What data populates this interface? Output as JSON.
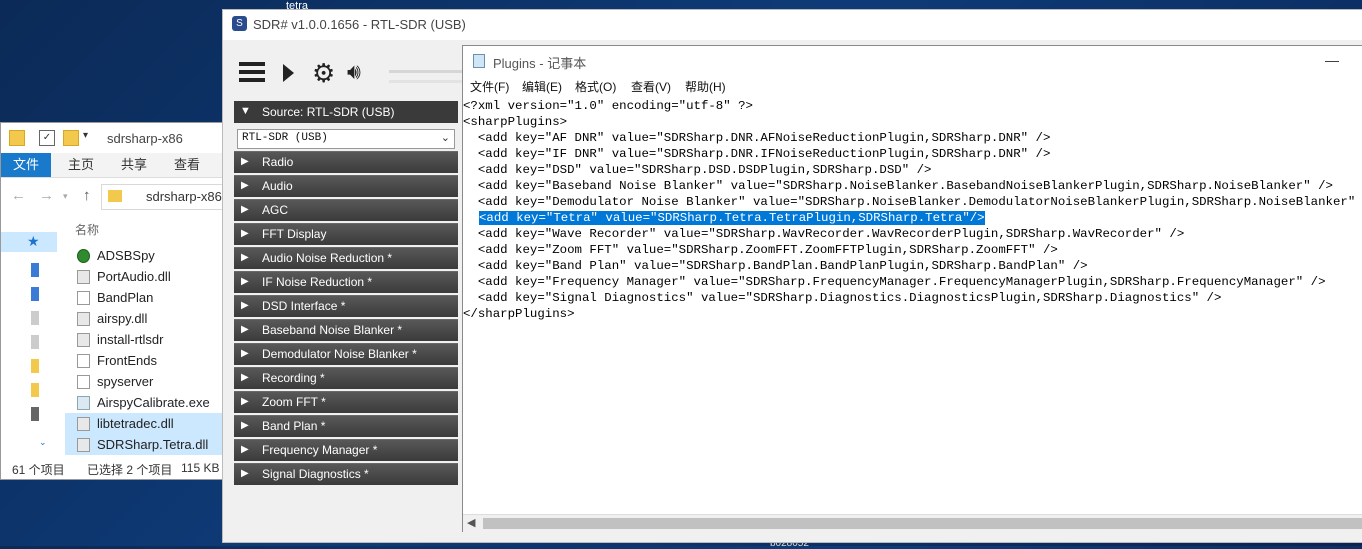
{
  "desktop": {
    "top_label": "tetra",
    "bottom_label": "b028052"
  },
  "explorer": {
    "title": "sdrsharp-x86",
    "ribbon_tabs": [
      "文件",
      "主页",
      "共享",
      "查看"
    ],
    "address": "sdrsharp-x86",
    "column_name": "名称",
    "files": [
      {
        "name": "ADSBSpy",
        "icon": "adsbspy-app-icon",
        "selected": false
      },
      {
        "name": "PortAudio.dll",
        "icon": "dll-file-icon",
        "selected": false
      },
      {
        "name": "BandPlan",
        "icon": "xml-file-icon",
        "selected": false
      },
      {
        "name": "airspy.dll",
        "icon": "dll-file-icon",
        "selected": false
      },
      {
        "name": "install-rtlsdr",
        "icon": "batch-file-icon",
        "selected": false
      },
      {
        "name": "FrontEnds",
        "icon": "xml-file-icon",
        "selected": false
      },
      {
        "name": "spyserver",
        "icon": "file-icon",
        "selected": false
      },
      {
        "name": "AirspyCalibrate.exe",
        "icon": "exe-file-icon",
        "selected": false
      },
      {
        "name": "libtetradec.dll",
        "icon": "dll-file-icon",
        "selected": true
      },
      {
        "name": "SDRSharp.Tetra.dll",
        "icon": "dll-file-icon",
        "selected": true
      }
    ],
    "status": {
      "count": "61 个项目",
      "selected": "已选择 2 个项目",
      "size": "115 KB"
    }
  },
  "sdr": {
    "title": "SDR# v1.0.0.1656 - RTL-SDR (USB)",
    "source_header": "Source: RTL-SDR (USB)",
    "source_value": "RTL-SDR (USB)",
    "panels": [
      "Radio",
      "Audio",
      "AGC",
      "FFT Display",
      "Audio Noise Reduction *",
      "IF Noise Reduction *",
      "DSD Interface *",
      "Baseband Noise Blanker *",
      "Demodulator Noise Blanker *",
      "Recording *",
      "Zoom FFT *",
      "Band Plan *",
      "Frequency Manager *",
      "Signal Diagnostics *"
    ]
  },
  "notepad": {
    "title": "Plugins - 记事本",
    "menu": [
      "文件(F)",
      "编辑(E)",
      "格式(O)",
      "查看(V)",
      "帮助(H)"
    ],
    "lines": [
      "<?xml version=\"1.0\" encoding=\"utf-8\" ?>",
      "<sharpPlugins>",
      "  <add key=\"AF DNR\" value=\"SDRSharp.DNR.AFNoiseReductionPlugin,SDRSharp.DNR\" />",
      "  <add key=\"IF DNR\" value=\"SDRSharp.DNR.IFNoiseReductionPlugin,SDRSharp.DNR\" />",
      "  <add key=\"DSD\" value=\"SDRSharp.DSD.DSDPlugin,SDRSharp.DSD\" />",
      "  <add key=\"Baseband Noise Blanker\" value=\"SDRSharp.NoiseBlanker.BasebandNoiseBlankerPlugin,SDRSharp.NoiseBlanker\" />",
      "  <add key=\"Demodulator Noise Blanker\" value=\"SDRSharp.NoiseBlanker.DemodulatorNoiseBlankerPlugin,SDRSharp.NoiseBlanker\" />",
      "<add key=\"Tetra\" value=\"SDRSharp.Tetra.TetraPlugin,SDRSharp.Tetra\"/>",
      "  <add key=\"Wave Recorder\" value=\"SDRSharp.WavRecorder.WavRecorderPlugin,SDRSharp.WavRecorder\" />",
      "  <add key=\"Zoom FFT\" value=\"SDRSharp.ZoomFFT.ZoomFFTPlugin,SDRSharp.ZoomFFT\" />",
      "  <add key=\"Band Plan\" value=\"SDRSharp.BandPlan.BandPlanPlugin,SDRSharp.BandPlan\" />",
      "  <add key=\"Frequency Manager\" value=\"SDRSharp.FrequencyManager.FrequencyManagerPlugin,SDRSharp.FrequencyManager\" />",
      "  <add key=\"Signal Diagnostics\" value=\"SDRSharp.Diagnostics.DiagnosticsPlugin,SDRSharp.Diagnostics\" />",
      "</sharpPlugins>"
    ],
    "highlighted_line": 7,
    "highlight_color": "#0078d7"
  }
}
